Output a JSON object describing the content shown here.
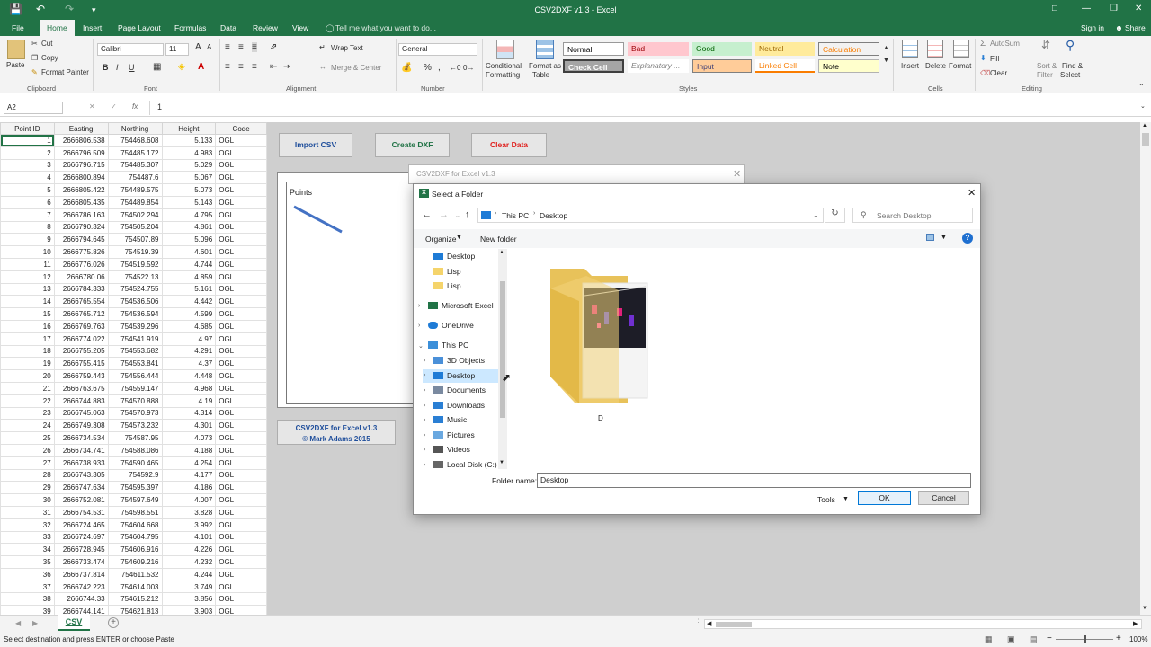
{
  "window": {
    "title": "CSV2DXF v1.3 - Excel"
  },
  "tabs": [
    "File",
    "Home",
    "Insert",
    "Page Layout",
    "Formulas",
    "Data",
    "Review",
    "View"
  ],
  "tell_me": "Tell me what you want to do...",
  "account": {
    "sign_in": "Sign in",
    "share": "Share"
  },
  "ribbon": {
    "clipboard": {
      "paste": "Paste",
      "cut": "Cut",
      "copy": "Copy",
      "format_painter": "Format Painter",
      "group": "Clipboard"
    },
    "font": {
      "name": "Calibri",
      "size": "11",
      "bold": "B",
      "italic": "I",
      "underline": "U",
      "grow": "A",
      "shrink": "A",
      "group": "Font"
    },
    "alignment": {
      "wrap": "Wrap Text",
      "merge": "Merge & Center",
      "group": "Alignment"
    },
    "number": {
      "format": "General",
      "percent": "%",
      "comma": ",",
      "group": "Number"
    },
    "cond": {
      "l1": "Conditional",
      "l2": "Formatting"
    },
    "fmt_table": {
      "l1": "Format as",
      "l2": "Table"
    },
    "styles": [
      {
        "label": "Normal",
        "bg": "#ffffff",
        "fg": "#000000"
      },
      {
        "label": "Bad",
        "bg": "#ffc7ce",
        "fg": "#9c0006"
      },
      {
        "label": "Good",
        "bg": "#c6efce",
        "fg": "#006100"
      },
      {
        "label": "Neutral",
        "bg": "#ffeb9c",
        "fg": "#9c6500"
      },
      {
        "label": "Calculation",
        "bg": "#f2f2f2",
        "fg": "#fa7d00"
      },
      {
        "label": "Check Cell",
        "bg": "#a5a5a5",
        "fg": "#ffffff"
      },
      {
        "label": "Explanatory ...",
        "bg": "#ffffff",
        "fg": "#7f7f7f"
      },
      {
        "label": "Input",
        "bg": "#ffcc99",
        "fg": "#3f3f76"
      },
      {
        "label": "Linked Cell",
        "bg": "#ffffff",
        "fg": "#fa7d00"
      },
      {
        "label": "Note",
        "bg": "#ffffcc",
        "fg": "#000000"
      }
    ],
    "styles_group": "Styles",
    "cells": {
      "insert": "Insert",
      "delete": "Delete",
      "format": "Format",
      "group": "Cells"
    },
    "editing": {
      "autosum": "AutoSum",
      "fill": "Fill",
      "clear": "Clear",
      "sort1": "Sort &",
      "sort2": "Filter",
      "find1": "Find &",
      "find2": "Select",
      "group": "Editing"
    }
  },
  "formula_bar": {
    "name_box": "A2",
    "fx": "fx",
    "value": "1"
  },
  "sheet": {
    "headers": [
      "Point ID",
      "Easting",
      "Northing",
      "Height",
      "Code"
    ],
    "rows": [
      [
        "1",
        "2666806.538",
        "754468.608",
        "5.133",
        "OGL"
      ],
      [
        "2",
        "2666796.509",
        "754485.172",
        "4.983",
        "OGL"
      ],
      [
        "3",
        "2666796.715",
        "754485.307",
        "5.029",
        "OGL"
      ],
      [
        "4",
        "2666800.894",
        "754487.6",
        "5.067",
        "OGL"
      ],
      [
        "5",
        "2666805.422",
        "754489.575",
        "5.073",
        "OGL"
      ],
      [
        "6",
        "2666805.435",
        "754489.854",
        "5.143",
        "OGL"
      ],
      [
        "7",
        "2666786.163",
        "754502.294",
        "4.795",
        "OGL"
      ],
      [
        "8",
        "2666790.324",
        "754505.204",
        "4.861",
        "OGL"
      ],
      [
        "9",
        "2666794.645",
        "754507.89",
        "5.096",
        "OGL"
      ],
      [
        "10",
        "2666775.826",
        "754519.39",
        "4.601",
        "OGL"
      ],
      [
        "11",
        "2666776.026",
        "754519.592",
        "4.744",
        "OGL"
      ],
      [
        "12",
        "2666780.06",
        "754522.13",
        "4.859",
        "OGL"
      ],
      [
        "13",
        "2666784.333",
        "754524.755",
        "5.161",
        "OGL"
      ],
      [
        "14",
        "2666765.554",
        "754536.506",
        "4.442",
        "OGL"
      ],
      [
        "15",
        "2666765.712",
        "754536.594",
        "4.599",
        "OGL"
      ],
      [
        "16",
        "2666769.763",
        "754539.296",
        "4.685",
        "OGL"
      ],
      [
        "17",
        "2666774.022",
        "754541.919",
        "4.97",
        "OGL"
      ],
      [
        "18",
        "2666755.205",
        "754553.682",
        "4.291",
        "OGL"
      ],
      [
        "19",
        "2666755.415",
        "754553.841",
        "4.37",
        "OGL"
      ],
      [
        "20",
        "2666759.443",
        "754556.444",
        "4.448",
        "OGL"
      ],
      [
        "21",
        "2666763.675",
        "754559.147",
        "4.968",
        "OGL"
      ],
      [
        "22",
        "2666744.883",
        "754570.888",
        "4.19",
        "OGL"
      ],
      [
        "23",
        "2666745.063",
        "754570.973",
        "4.314",
        "OGL"
      ],
      [
        "24",
        "2666749.308",
        "754573.232",
        "4.301",
        "OGL"
      ],
      [
        "25",
        "2666734.534",
        "754587.95",
        "4.073",
        "OGL"
      ],
      [
        "26",
        "2666734.741",
        "754588.086",
        "4.188",
        "OGL"
      ],
      [
        "27",
        "2666738.933",
        "754590.465",
        "4.254",
        "OGL"
      ],
      [
        "28",
        "2666743.305",
        "754592.9",
        "4.177",
        "OGL"
      ],
      [
        "29",
        "2666747.634",
        "754595.397",
        "4.186",
        "OGL"
      ],
      [
        "30",
        "2666752.081",
        "754597.649",
        "4.007",
        "OGL"
      ],
      [
        "31",
        "2666754.531",
        "754598.551",
        "3.828",
        "OGL"
      ],
      [
        "32",
        "2666724.465",
        "754604.668",
        "3.992",
        "OGL"
      ],
      [
        "33",
        "2666724.697",
        "754604.795",
        "4.101",
        "OGL"
      ],
      [
        "34",
        "2666728.945",
        "754606.916",
        "4.226",
        "OGL"
      ],
      [
        "35",
        "2666733.474",
        "754609.216",
        "4.232",
        "OGL"
      ],
      [
        "36",
        "2666737.814",
        "754611.532",
        "4.244",
        "OGL"
      ],
      [
        "37",
        "2666742.223",
        "754614.003",
        "3.749",
        "OGL"
      ],
      [
        "38",
        "2666744.33",
        "754615.212",
        "3.856",
        "OGL"
      ],
      [
        "39",
        "2666744.141",
        "754621.813",
        "3.903",
        "OGL"
      ]
    ]
  },
  "buttons": {
    "import": "Import CSV",
    "create": "Create DXF",
    "clear": "Clear Data"
  },
  "chart": {
    "title": "Points"
  },
  "credit": {
    "line1": "CSV2DXF for Excel v1.3",
    "line2": "© Mark Adams 2015"
  },
  "back_dialog": {
    "title": "CSV2DXF for Excel v1.3"
  },
  "dialog": {
    "title": "Select a Folder",
    "crumbs": [
      "This PC",
      "Desktop"
    ],
    "search_placeholder": "Search Desktop",
    "organize": "Organize",
    "new_folder": "New folder",
    "nav": [
      {
        "label": "Desktop",
        "icon": "desktop-icon",
        "color": "#1e7bd6"
      },
      {
        "label": "Lisp",
        "icon": "folder-icon",
        "color": "#f5d46b"
      },
      {
        "label": "Lisp",
        "icon": "folder-icon",
        "color": "#f5d46b"
      },
      {
        "label": "Microsoft Excel",
        "icon": "excel-icon",
        "color": "#217346"
      },
      {
        "label": "OneDrive",
        "icon": "onedrive-icon",
        "color": "#1e7bd6"
      },
      {
        "label": "This PC",
        "icon": "computer-icon",
        "color": "#3b8fd9"
      },
      {
        "label": "3D Objects",
        "icon": "cube-icon",
        "color": "#4a90d9"
      },
      {
        "label": "Desktop",
        "icon": "desktop-icon",
        "color": "#1e7bd6"
      },
      {
        "label": "Documents",
        "icon": "document-icon",
        "color": "#7a8aa0"
      },
      {
        "label": "Downloads",
        "icon": "download-icon",
        "color": "#2a7fd4"
      },
      {
        "label": "Music",
        "icon": "music-icon",
        "color": "#2a7fd4"
      },
      {
        "label": "Pictures",
        "icon": "picture-icon",
        "color": "#6aa8e0"
      },
      {
        "label": "Videos",
        "icon": "video-icon",
        "color": "#555555"
      },
      {
        "label": "Local Disk (C:)",
        "icon": "disk-icon",
        "color": "#666666"
      }
    ],
    "folder_item": "D",
    "folder_name_label": "Folder name:",
    "folder_name_value": "Desktop",
    "tools": "Tools",
    "ok": "OK",
    "cancel": "Cancel"
  },
  "sheet_tab": "CSV",
  "status": {
    "text": "Select destination and press ENTER or choose Paste",
    "zoom": "100%"
  }
}
